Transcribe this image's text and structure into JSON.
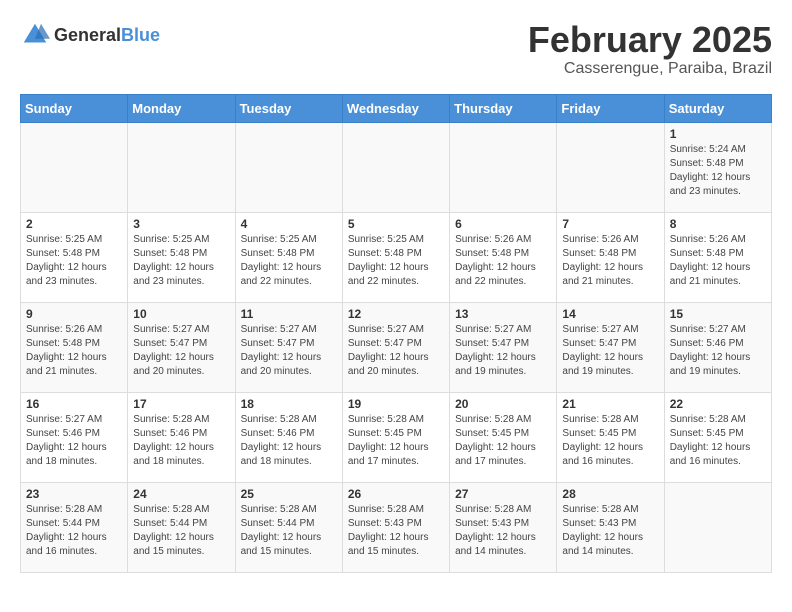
{
  "header": {
    "logo_general": "General",
    "logo_blue": "Blue",
    "main_title": "February 2025",
    "subtitle": "Casserengue, Paraiba, Brazil"
  },
  "calendar": {
    "days_of_week": [
      "Sunday",
      "Monday",
      "Tuesday",
      "Wednesday",
      "Thursday",
      "Friday",
      "Saturday"
    ],
    "weeks": [
      [
        {
          "day": "",
          "info": ""
        },
        {
          "day": "",
          "info": ""
        },
        {
          "day": "",
          "info": ""
        },
        {
          "day": "",
          "info": ""
        },
        {
          "day": "",
          "info": ""
        },
        {
          "day": "",
          "info": ""
        },
        {
          "day": "1",
          "info": "Sunrise: 5:24 AM\nSunset: 5:48 PM\nDaylight: 12 hours\nand 23 minutes."
        }
      ],
      [
        {
          "day": "2",
          "info": "Sunrise: 5:25 AM\nSunset: 5:48 PM\nDaylight: 12 hours\nand 23 minutes."
        },
        {
          "day": "3",
          "info": "Sunrise: 5:25 AM\nSunset: 5:48 PM\nDaylight: 12 hours\nand 23 minutes."
        },
        {
          "day": "4",
          "info": "Sunrise: 5:25 AM\nSunset: 5:48 PM\nDaylight: 12 hours\nand 22 minutes."
        },
        {
          "day": "5",
          "info": "Sunrise: 5:25 AM\nSunset: 5:48 PM\nDaylight: 12 hours\nand 22 minutes."
        },
        {
          "day": "6",
          "info": "Sunrise: 5:26 AM\nSunset: 5:48 PM\nDaylight: 12 hours\nand 22 minutes."
        },
        {
          "day": "7",
          "info": "Sunrise: 5:26 AM\nSunset: 5:48 PM\nDaylight: 12 hours\nand 21 minutes."
        },
        {
          "day": "8",
          "info": "Sunrise: 5:26 AM\nSunset: 5:48 PM\nDaylight: 12 hours\nand 21 minutes."
        }
      ],
      [
        {
          "day": "9",
          "info": "Sunrise: 5:26 AM\nSunset: 5:48 PM\nDaylight: 12 hours\nand 21 minutes."
        },
        {
          "day": "10",
          "info": "Sunrise: 5:27 AM\nSunset: 5:47 PM\nDaylight: 12 hours\nand 20 minutes."
        },
        {
          "day": "11",
          "info": "Sunrise: 5:27 AM\nSunset: 5:47 PM\nDaylight: 12 hours\nand 20 minutes."
        },
        {
          "day": "12",
          "info": "Sunrise: 5:27 AM\nSunset: 5:47 PM\nDaylight: 12 hours\nand 20 minutes."
        },
        {
          "day": "13",
          "info": "Sunrise: 5:27 AM\nSunset: 5:47 PM\nDaylight: 12 hours\nand 19 minutes."
        },
        {
          "day": "14",
          "info": "Sunrise: 5:27 AM\nSunset: 5:47 PM\nDaylight: 12 hours\nand 19 minutes."
        },
        {
          "day": "15",
          "info": "Sunrise: 5:27 AM\nSunset: 5:46 PM\nDaylight: 12 hours\nand 19 minutes."
        }
      ],
      [
        {
          "day": "16",
          "info": "Sunrise: 5:27 AM\nSunset: 5:46 PM\nDaylight: 12 hours\nand 18 minutes."
        },
        {
          "day": "17",
          "info": "Sunrise: 5:28 AM\nSunset: 5:46 PM\nDaylight: 12 hours\nand 18 minutes."
        },
        {
          "day": "18",
          "info": "Sunrise: 5:28 AM\nSunset: 5:46 PM\nDaylight: 12 hours\nand 18 minutes."
        },
        {
          "day": "19",
          "info": "Sunrise: 5:28 AM\nSunset: 5:45 PM\nDaylight: 12 hours\nand 17 minutes."
        },
        {
          "day": "20",
          "info": "Sunrise: 5:28 AM\nSunset: 5:45 PM\nDaylight: 12 hours\nand 17 minutes."
        },
        {
          "day": "21",
          "info": "Sunrise: 5:28 AM\nSunset: 5:45 PM\nDaylight: 12 hours\nand 16 minutes."
        },
        {
          "day": "22",
          "info": "Sunrise: 5:28 AM\nSunset: 5:45 PM\nDaylight: 12 hours\nand 16 minutes."
        }
      ],
      [
        {
          "day": "23",
          "info": "Sunrise: 5:28 AM\nSunset: 5:44 PM\nDaylight: 12 hours\nand 16 minutes."
        },
        {
          "day": "24",
          "info": "Sunrise: 5:28 AM\nSunset: 5:44 PM\nDaylight: 12 hours\nand 15 minutes."
        },
        {
          "day": "25",
          "info": "Sunrise: 5:28 AM\nSunset: 5:44 PM\nDaylight: 12 hours\nand 15 minutes."
        },
        {
          "day": "26",
          "info": "Sunrise: 5:28 AM\nSunset: 5:43 PM\nDaylight: 12 hours\nand 15 minutes."
        },
        {
          "day": "27",
          "info": "Sunrise: 5:28 AM\nSunset: 5:43 PM\nDaylight: 12 hours\nand 14 minutes."
        },
        {
          "day": "28",
          "info": "Sunrise: 5:28 AM\nSunset: 5:43 PM\nDaylight: 12 hours\nand 14 minutes."
        },
        {
          "day": "",
          "info": ""
        }
      ]
    ]
  }
}
